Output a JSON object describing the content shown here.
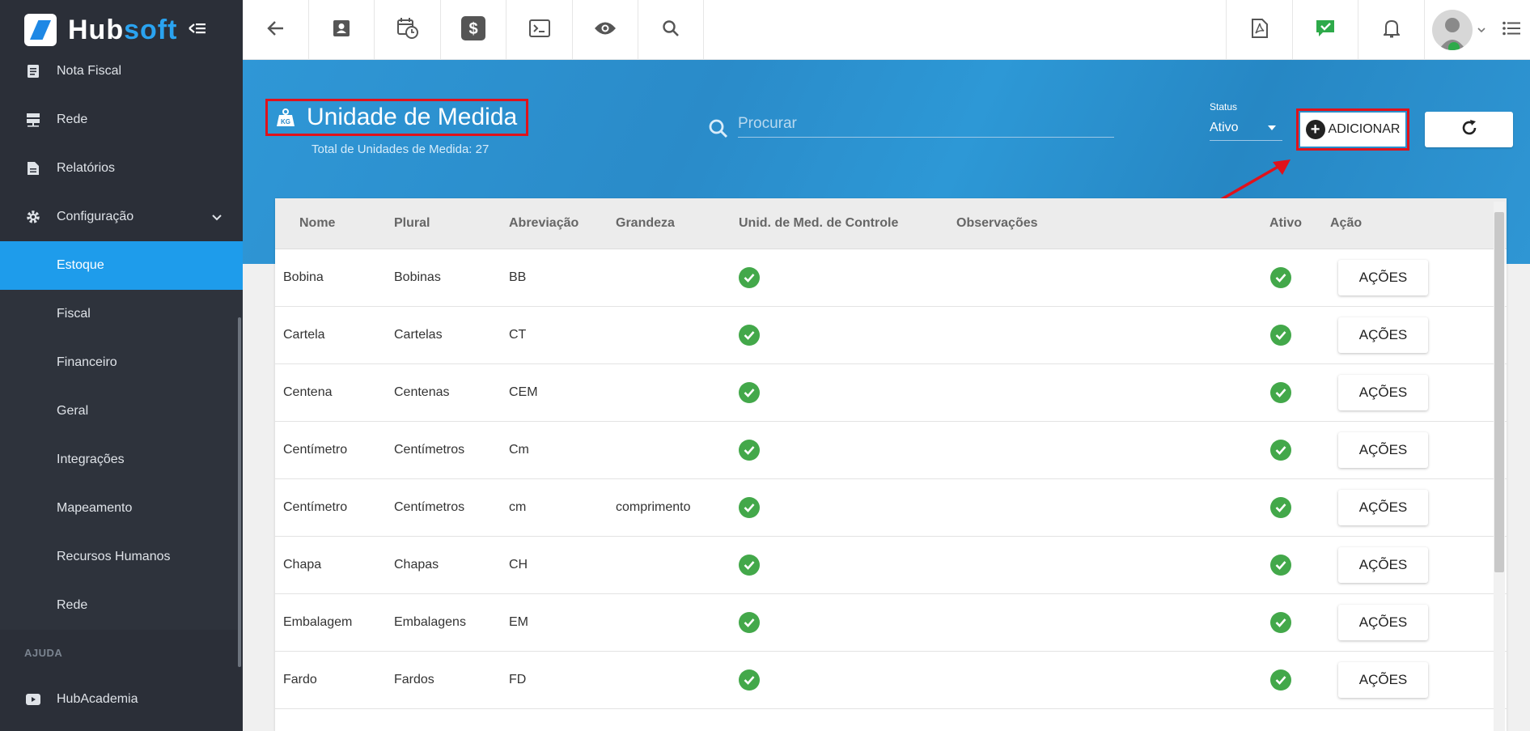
{
  "app": {
    "brand_hub": "Hub",
    "brand_soft": "soft"
  },
  "sidebar": {
    "items": [
      {
        "label": "Nota Fiscal",
        "icon": "document-icon"
      },
      {
        "label": "Rede",
        "icon": "server-icon"
      },
      {
        "label": "Relatórios",
        "icon": "report-icon"
      },
      {
        "label": "Configuração",
        "icon": "gear-icon"
      }
    ],
    "sub_items": [
      "Estoque",
      "Fiscal",
      "Financeiro",
      "Geral",
      "Integrações",
      "Mapeamento",
      "Recursos Humanos",
      "Rede"
    ],
    "active_sub": "Estoque",
    "section_label": "AJUDA",
    "help_items": [
      {
        "label": "HubAcademia",
        "icon": "youtube-icon"
      }
    ]
  },
  "topbar": {
    "left_icons": [
      "back-arrow-icon",
      "contact-card-icon",
      "calendar-clock-icon",
      "dollar-icon",
      "terminal-icon",
      "eye-icon",
      "search-icon"
    ],
    "right_icons": [
      "pdf-icon",
      "chat-check-icon",
      "bell-icon",
      "avatar",
      "menu-icon"
    ]
  },
  "header": {
    "title": "Unidade de Medida",
    "subtitle": "Total de Unidades de Medida: 27",
    "search_placeholder": "Procurar",
    "status_label": "Status",
    "status_value": "Ativo",
    "add_label": "ADICIONAR"
  },
  "table": {
    "columns": [
      "Nome",
      "Plural",
      "Abreviação",
      "Grandeza",
      "Unid. de Med. de Controle",
      "Observações",
      "Ativo",
      "Ação"
    ],
    "action_label": "AÇÕES",
    "rows": [
      {
        "nome": "Bobina",
        "plural": "Bobinas",
        "abrev": "BB",
        "grandeza": "",
        "controle": true,
        "obs": "",
        "ativo": true
      },
      {
        "nome": "Cartela",
        "plural": "Cartelas",
        "abrev": "CT",
        "grandeza": "",
        "controle": true,
        "obs": "",
        "ativo": true
      },
      {
        "nome": "Centena",
        "plural": "Centenas",
        "abrev": "CEM",
        "grandeza": "",
        "controle": true,
        "obs": "",
        "ativo": true
      },
      {
        "nome": "Centímetro",
        "plural": "Centímetros",
        "abrev": "Cm",
        "grandeza": "",
        "controle": true,
        "obs": "",
        "ativo": true
      },
      {
        "nome": "Centímetro",
        "plural": "Centímetros",
        "abrev": "cm",
        "grandeza": "comprimento",
        "controle": true,
        "obs": "",
        "ativo": true
      },
      {
        "nome": "Chapa",
        "plural": "Chapas",
        "abrev": "CH",
        "grandeza": "",
        "controle": true,
        "obs": "",
        "ativo": true
      },
      {
        "nome": "Embalagem",
        "plural": "Embalagens",
        "abrev": "EM",
        "grandeza": "",
        "controle": true,
        "obs": "",
        "ativo": true
      },
      {
        "nome": "Fardo",
        "plural": "Fardos",
        "abrev": "FD",
        "grandeza": "",
        "controle": true,
        "obs": "",
        "ativo": true
      }
    ]
  },
  "colors": {
    "sidebar_bg": "#2b2f38",
    "active_item": "#1e9ceb",
    "header_blue": "#2a8bc9",
    "check_green": "#43a84a",
    "highlight_red": "#e0121b"
  }
}
